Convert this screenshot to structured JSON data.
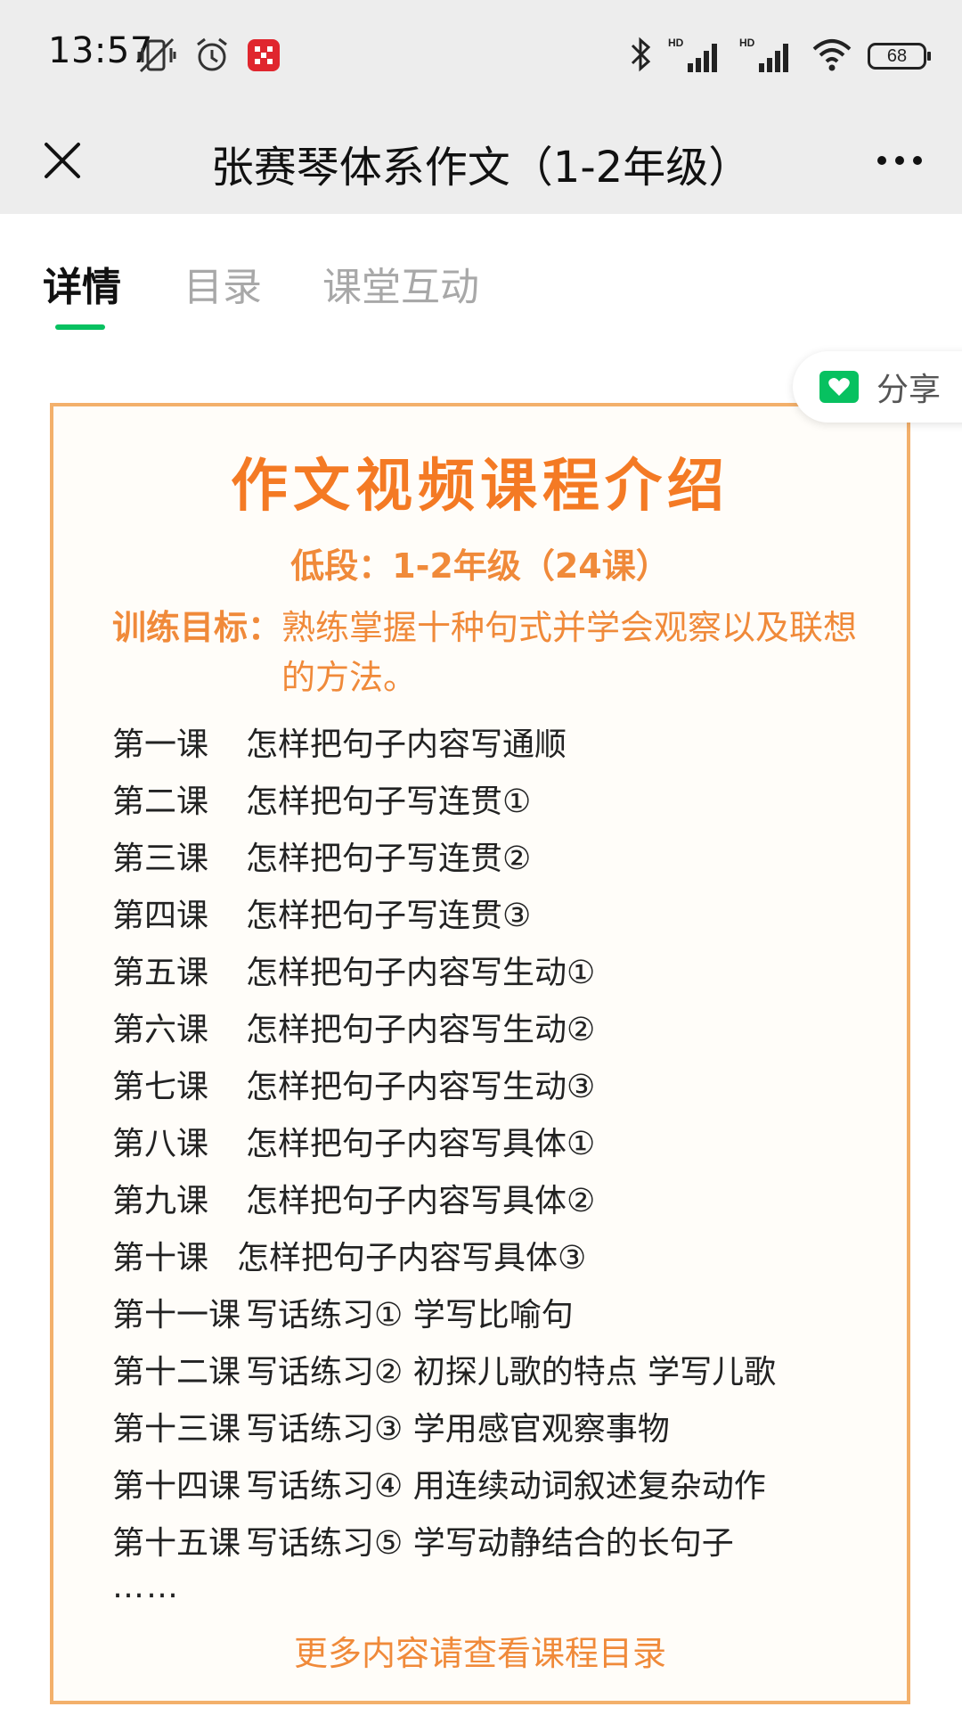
{
  "status_bar": {
    "time": "13:57",
    "battery": "68",
    "icons": [
      "mute-vibrate-icon",
      "alarm-icon",
      "app-notification-icon",
      "bluetooth-icon",
      "hd-signal-icon",
      "hd-signal-icon",
      "wifi-icon",
      "battery-icon"
    ]
  },
  "header": {
    "title": "张赛琴体系作文（1-2年级）"
  },
  "tabs": [
    {
      "label": "详情",
      "active": true
    },
    {
      "label": "目录",
      "active": false
    },
    {
      "label": "课堂互动",
      "active": false
    }
  ],
  "share": {
    "label": "分享"
  },
  "poster": {
    "title": "作文视频课程介绍",
    "subtitle": "低段：1-2年级（24课）",
    "goal_label": "训练目标：",
    "goal_text": "熟练掌握十种句式并学会观察以及联想的方法。",
    "lessons": [
      {
        "no": "第一课",
        "topic": "怎样把句子内容写通顺"
      },
      {
        "no": "第二课",
        "topic": "怎样把句子写连贯①"
      },
      {
        "no": "第三课",
        "topic": "怎样把句子写连贯②"
      },
      {
        "no": "第四课",
        "topic": "怎样把句子写连贯③"
      },
      {
        "no": "第五课",
        "topic": "怎样把句子内容写生动①"
      },
      {
        "no": "第六课",
        "topic": "怎样把句子内容写生动②"
      },
      {
        "no": "第七课",
        "topic": "怎样把句子内容写生动③"
      },
      {
        "no": "第八课",
        "topic": "怎样把句子内容写具体①"
      },
      {
        "no": "第九课",
        "topic": "怎样把句子内容写具体②"
      },
      {
        "no": "第十课",
        "topic": "怎样把句子内容写具体③"
      },
      {
        "no": "第十一课",
        "topic": "写话练习① 学写比喻句"
      },
      {
        "no": "第十二课",
        "topic": "写话练习② 初探儿歌的特点 学写儿歌"
      },
      {
        "no": "第十三课",
        "topic": "写话练习③ 学用感官观察事物"
      },
      {
        "no": "第十四课",
        "topic": "写话练习④ 用连续动词叙述复杂动作"
      },
      {
        "no": "第十五课",
        "topic": "写话练习⑤ 学写动静结合的长句子"
      }
    ],
    "ellipsis": "……",
    "more_link": "更多内容请查看课程目录"
  },
  "colors": {
    "accent_green": "#07c160",
    "poster_orange": "#f47a24",
    "poster_border": "#f3b06b",
    "bar_gray": "#ededed"
  }
}
